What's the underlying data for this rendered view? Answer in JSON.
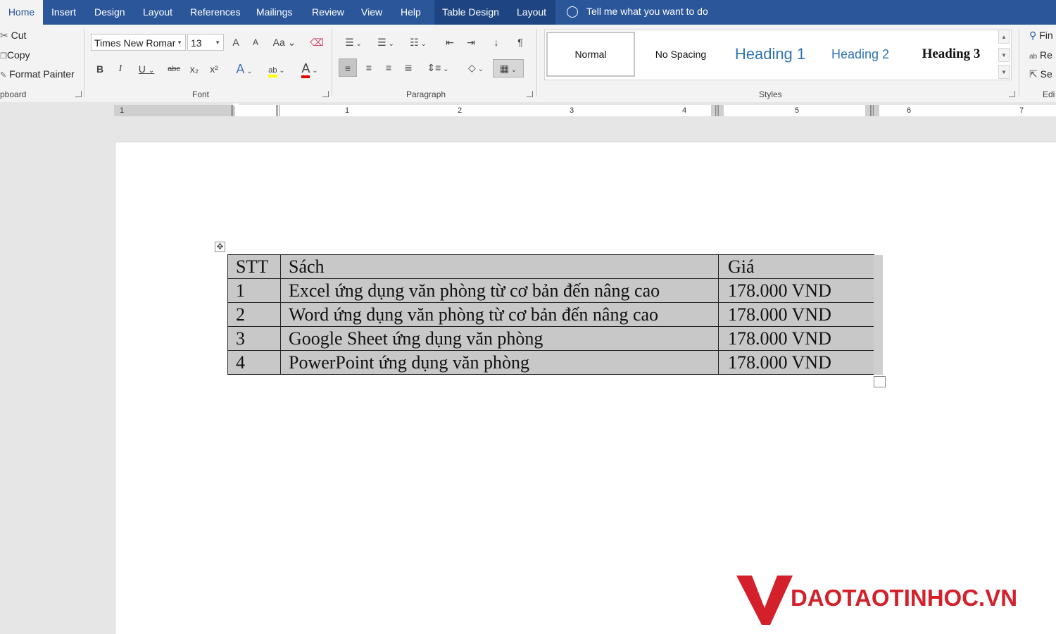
{
  "tabs": [
    {
      "label": "Home",
      "active": true
    },
    {
      "label": "Insert"
    },
    {
      "label": "Design"
    },
    {
      "label": "Layout"
    },
    {
      "label": "References"
    },
    {
      "label": "Mailings"
    },
    {
      "label": "Review"
    },
    {
      "label": "View"
    },
    {
      "label": "Help"
    },
    {
      "label": "Table Design",
      "contextual": true
    },
    {
      "label": "Layout",
      "contextual": true
    }
  ],
  "tell_me": "Tell me what you want to do",
  "clipboard": {
    "cut": "Cut",
    "copy": "Copy",
    "format_painter": "Format Painter",
    "group_label": "pboard"
  },
  "font": {
    "name": "Times New Romar",
    "size": "13",
    "group_label": "Font",
    "grow": "A",
    "shrink": "A",
    "change_case": "Aa",
    "bold": "B",
    "italic": "I",
    "underline": "U",
    "strike": "abc",
    "sub": "x₂",
    "sup": "x²",
    "effects": "A",
    "highlight": "ab",
    "color": "A"
  },
  "paragraph": {
    "group_label": "Paragraph",
    "sort": "↓",
    "pilcrow": "¶"
  },
  "styles": {
    "group_label": "Styles",
    "items": [
      {
        "label": "Normal"
      },
      {
        "label": "No Spacing"
      },
      {
        "label": "Heading 1"
      },
      {
        "label": "Heading 2"
      },
      {
        "label": "Heading 3"
      }
    ]
  },
  "editing": {
    "find": "Fin",
    "replace": "Re",
    "select": "Se",
    "group_label": "Edi"
  },
  "ruler": {
    "labels": [
      "1",
      "1",
      "2",
      "3",
      "4",
      "5",
      "6",
      "7"
    ]
  },
  "table": {
    "headers": [
      "STT",
      "Sách",
      "Giá"
    ],
    "rows": [
      [
        "1",
        "Excel ứng dụng văn phòng từ cơ bản đến nâng cao",
        "178.000 VND"
      ],
      [
        "2",
        "Word ứng dụng văn phòng từ cơ bản đến nâng cao",
        "178.000 VND"
      ],
      [
        "3",
        "Google Sheet ứng dụng văn phòng",
        "178.000 VND"
      ],
      [
        "4",
        "PowerPoint ứng dụng văn phòng",
        "178.000 VND"
      ]
    ]
  },
  "watermark": {
    "text": "DAOTAOTINHOC.VN",
    "color": "#d4202a"
  },
  "colors": {
    "ribbon_tab_bg": "#2b579a",
    "heading_blue": "#2e74b5",
    "highlight": "#ffff00",
    "font_color": "#e00000"
  }
}
